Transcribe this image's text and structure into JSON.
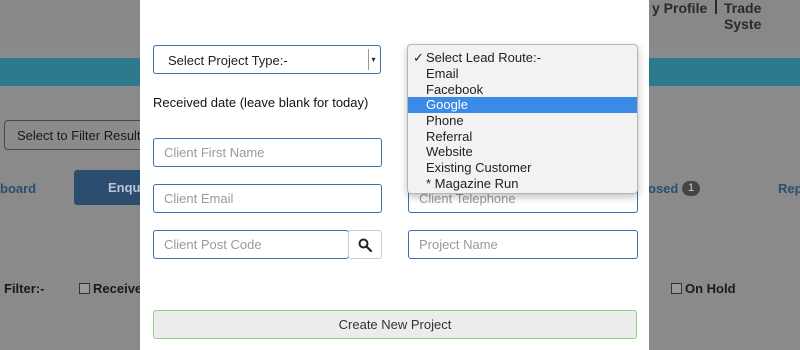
{
  "background": {
    "nav_profile": "y Profile",
    "nav_trade": "Trade Syste",
    "filter_results": "Select to Filter Results",
    "board_link": "board",
    "enquiries_tab": "Enqui",
    "closed_link": "osed",
    "closed_count": "1",
    "rep_link": "Rep",
    "filter_label": "Filter:-",
    "received_checkbox": "Received",
    "on_hold_checkbox": "On Hold"
  },
  "modal": {
    "project_type_select": "Select Project Type:-",
    "received_date_label": "Received date (leave blank for today)",
    "client_first_name_placeholder": "Client First Name",
    "client_email_placeholder": "Client Email",
    "client_telephone_placeholder": "Client Telephone",
    "client_post_code_placeholder": "Client Post Code",
    "project_name_placeholder": "Project Name",
    "create_button": "Create New Project"
  },
  "lead_route_dropdown": {
    "checkmark": "✓",
    "options": [
      "Select Lead Route:-",
      "Email",
      "Facebook",
      "Google",
      "Phone",
      "Referral",
      "Website",
      "Existing Customer",
      "* Magazine Run"
    ],
    "highlighted": "Google"
  },
  "colors": {
    "accent_blue": "#3a6fb0",
    "highlight": "#3a8ae6",
    "create_border": "#8fcf8f"
  }
}
